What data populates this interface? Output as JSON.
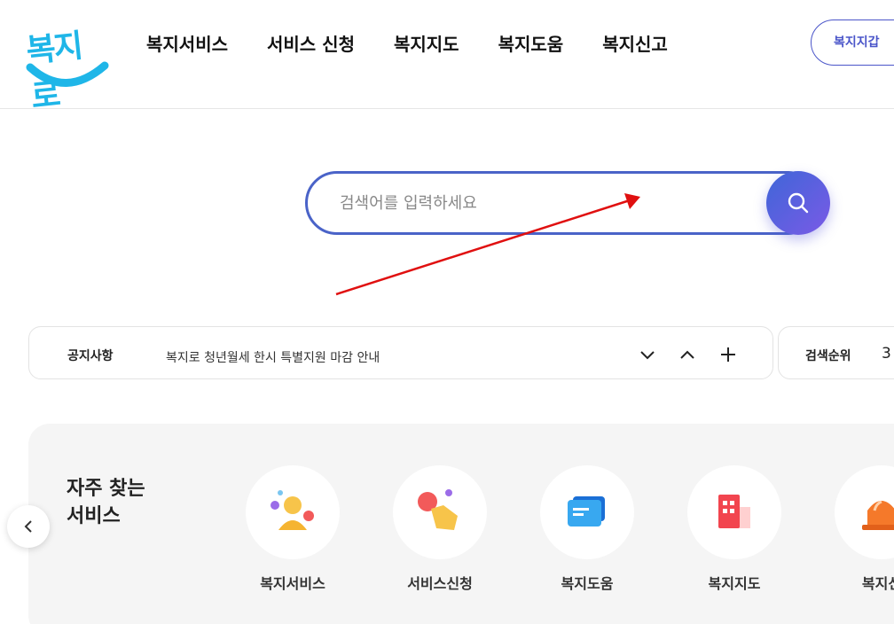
{
  "header": {
    "logo_text": "복지로",
    "nav": [
      "복지서비스",
      "서비스 신청",
      "복지지도",
      "복지도움",
      "복지신고"
    ],
    "wallet_button": "복지지갑"
  },
  "search": {
    "placeholder": "검색어를 입력하세요"
  },
  "notice": {
    "label": "공지사항",
    "text": "복지로 청년월세 한시 특별지원 마감 안내"
  },
  "ranking": {
    "label": "검색순위",
    "rank": "3"
  },
  "frequent": {
    "title_line1": "자주 찾는",
    "title_line2": "서비스",
    "items": [
      {
        "label": "복지서비스",
        "icon": "person-icon"
      },
      {
        "label": "서비스신청",
        "icon": "tap-hand-icon"
      },
      {
        "label": "복지도움",
        "icon": "chat-note-icon"
      },
      {
        "label": "복지지도",
        "icon": "building-icon"
      },
      {
        "label": "복지신",
        "icon": "siren-icon"
      }
    ]
  },
  "colors": {
    "brand_blue": "#4a63c8",
    "logo_cyan": "#1fb6e8",
    "annotation_red": "#e01010"
  }
}
